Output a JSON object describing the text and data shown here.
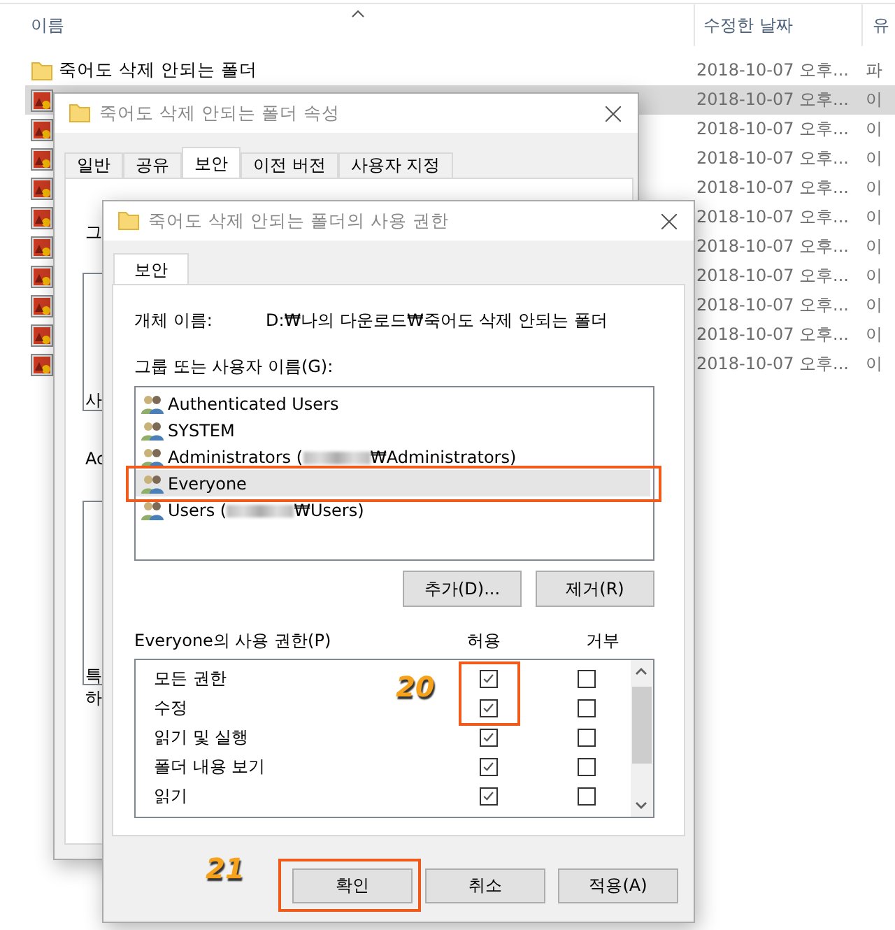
{
  "explorer": {
    "columns": [
      {
        "label": "이름"
      },
      {
        "label": "수정한 날짜"
      },
      {
        "label": "유"
      }
    ],
    "rows": [
      {
        "kind": "folder",
        "name": "죽어도 삭제 안되는 폴더",
        "date": "2018-10-07 오후...",
        "type": "파",
        "selected": false
      },
      {
        "kind": "image",
        "date": "2018-10-07 오후...",
        "type": "이",
        "selected": true
      },
      {
        "kind": "image",
        "date": "2018-10-07 오후...",
        "type": "이",
        "selected": false
      },
      {
        "kind": "image",
        "date": "2018-10-07 오후...",
        "type": "이",
        "selected": false
      },
      {
        "kind": "image",
        "date": "2018-10-07 오후...",
        "type": "이",
        "selected": false
      },
      {
        "kind": "image",
        "date": "2018-10-07 오후...",
        "type": "이",
        "selected": false
      },
      {
        "kind": "image",
        "date": "2018-10-07 오후...",
        "type": "이",
        "selected": false
      },
      {
        "kind": "image",
        "date": "2018-10-07 오후...",
        "type": "이",
        "selected": false
      },
      {
        "kind": "image",
        "date": "2018-10-07 오후...",
        "type": "이",
        "selected": false
      },
      {
        "kind": "image",
        "date": "2018-10-07 오후...",
        "type": "이",
        "selected": false
      },
      {
        "kind": "image",
        "date": "2018-10-07 오후...",
        "type": "이",
        "selected": false
      }
    ]
  },
  "properties_dialog": {
    "title": "죽어도 삭제 안되는 폴더 속성",
    "tabs": [
      {
        "label": "일반",
        "selected": false
      },
      {
        "label": "공유",
        "selected": false
      },
      {
        "label": "보안",
        "selected": true
      },
      {
        "label": "이전 버전",
        "selected": false
      },
      {
        "label": "사용자 지정",
        "selected": false
      }
    ],
    "fragments": [
      "그",
      "사",
      "Ac",
      "특",
      "하"
    ]
  },
  "permissions_dialog": {
    "title": "죽어도 삭제 안되는 폴더의 사용 권한",
    "tabs": [
      {
        "label": "보안",
        "selected": true
      }
    ],
    "object_name_label": "개체 이름:",
    "object_name": "D:₩나의 다운로드₩죽어도 삭제 안되는 폴더",
    "group_label": "그룹 또는 사용자 이름(G):",
    "principals": [
      {
        "name": "Authenticated Users",
        "selected": false,
        "highlighted": false
      },
      {
        "name": "SYSTEM",
        "selected": false,
        "highlighted": false
      },
      {
        "name": "Administrators (",
        "redacted": true,
        "name_after": "₩Administrators)",
        "selected": false,
        "highlighted": false
      },
      {
        "name": "Everyone",
        "selected": true,
        "highlighted": true
      },
      {
        "name": "Users (",
        "redacted": true,
        "name_after": "₩Users)",
        "selected": false,
        "highlighted": false
      }
    ],
    "add_button": "추가(D)...",
    "remove_button": "제거(R)",
    "permissions_label": "Everyone의 사용 권한(P)",
    "allow_header": "허용",
    "deny_header": "거부",
    "permissions": [
      {
        "name": "모든 권한",
        "allow": true,
        "deny": false,
        "highlighted": true
      },
      {
        "name": "수정",
        "allow": true,
        "deny": false,
        "highlighted": true
      },
      {
        "name": "읽기 및 실행",
        "allow": true,
        "deny": false,
        "highlighted": false
      },
      {
        "name": "폴더 내용 보기",
        "allow": true,
        "deny": false,
        "highlighted": false
      },
      {
        "name": "읽기",
        "allow": true,
        "deny": false,
        "highlighted": false
      }
    ],
    "buttons": [
      {
        "label": "확인",
        "highlighted": true
      },
      {
        "label": "취소",
        "highlighted": false
      },
      {
        "label": "적용(A)",
        "highlighted": false
      }
    ]
  },
  "annotations": {
    "permissions_callout": "20",
    "button_callout": "21"
  }
}
